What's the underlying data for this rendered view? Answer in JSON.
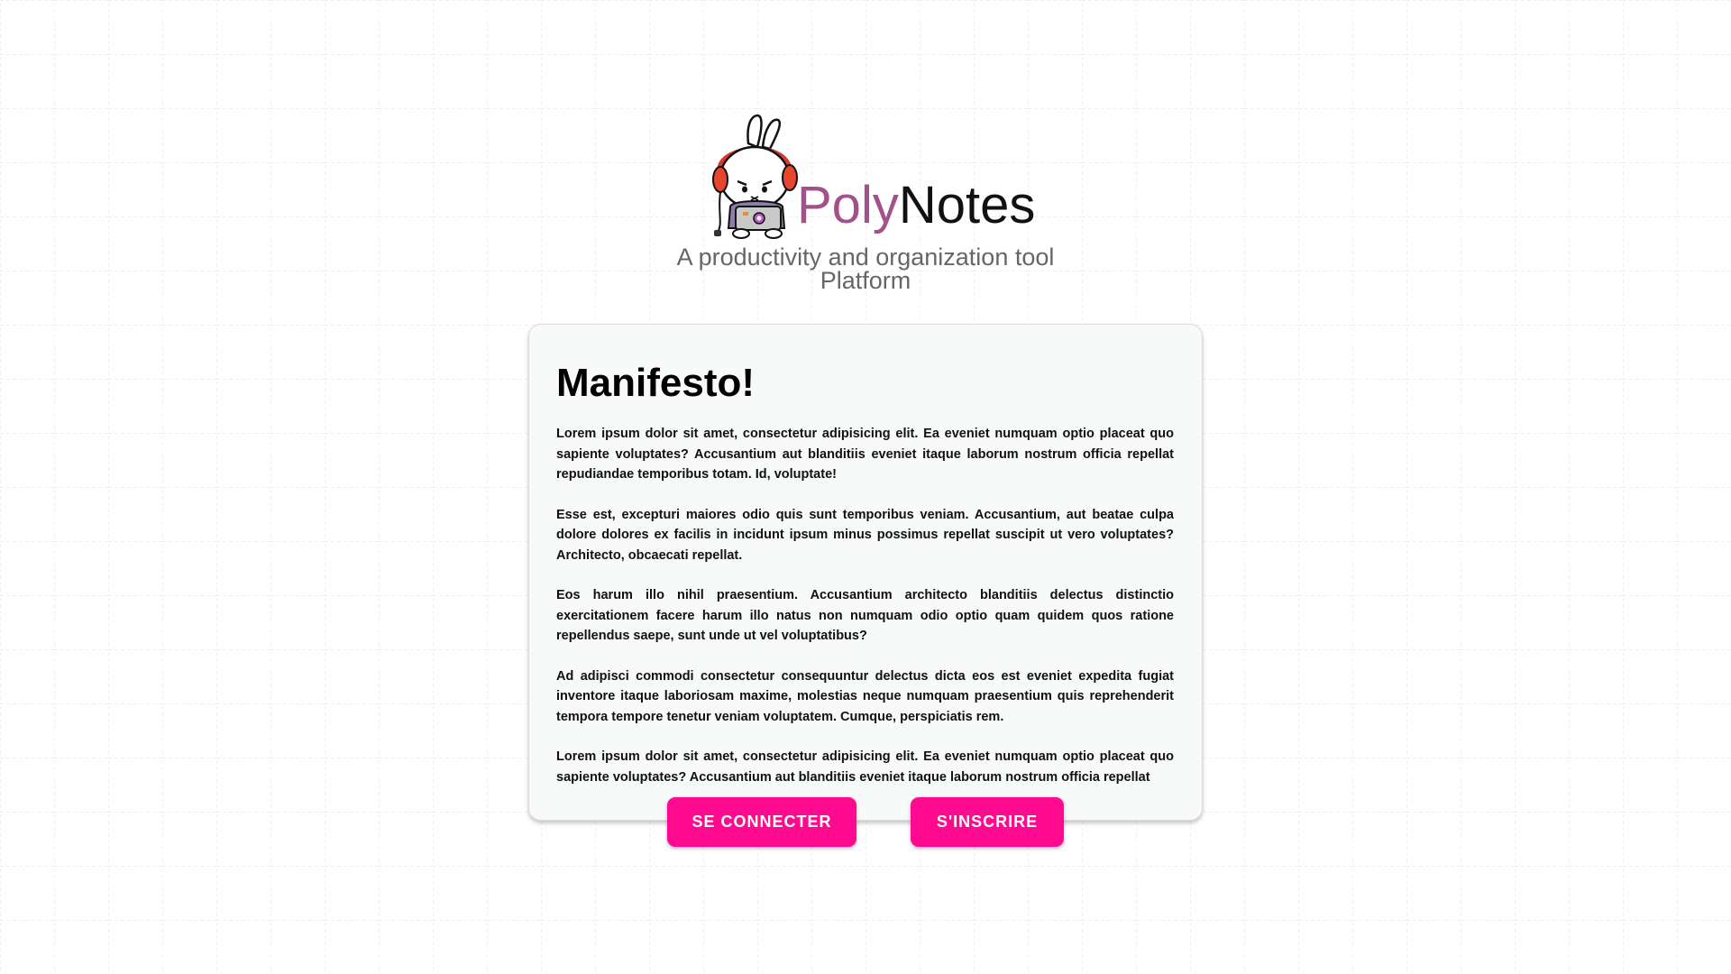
{
  "app": {
    "brand_part1": "Poly",
    "brand_part2": "Notes",
    "tagline": "A productivity and organization tool Platform",
    "mascot_icon": "rabbit-mascot-with-headphones-icon"
  },
  "colors": {
    "background": "#ffffff",
    "grid_line": "#e2e2e2",
    "brand_accent": "#a4508b",
    "button": "#ff0a8f",
    "button_text": "#ffffff",
    "card_background": "#f8f9f9"
  },
  "manifesto": {
    "title": "Manifesto!",
    "paragraphs": [
      "Lorem ipsum dolor sit amet, consectetur adipisicing elit. Ea eveniet numquam optio placeat quo sapiente voluptates? Accusantium aut blanditiis eveniet itaque laborum nostrum officia repellat repudiandae temporibus totam. Id, voluptate!",
      "Esse est, excepturi maiores odio quis sunt temporibus veniam. Accusantium, aut beatae culpa dolore dolores ex facilis in incidunt ipsum minus possimus repellat suscipit ut vero voluptates? Architecto, obcaecati repellat.",
      "Eos harum illo nihil praesentium. Accusantium architecto blanditiis delectus distinctio exercitationem facere harum illo natus non numquam odio optio quam quidem quos ratione repellendus saepe, sunt unde ut vel voluptatibus?",
      "Ad adipisci commodi consectetur consequuntur delectus dicta eos est eveniet expedita fugiat inventore itaque laboriosam maxime, molestias neque numquam praesentium quis reprehenderit tempora tempore tenetur veniam voluptatem. Cumque, perspiciatis rem.",
      "Lorem ipsum dolor sit amet, consectetur adipisicing elit. Ea eveniet numquam optio placeat quo sapiente voluptates? Accusantium aut blanditiis eveniet itaque laborum nostrum officia repellat"
    ]
  },
  "actions": {
    "login_label": "SE CONNECTER",
    "signup_label": "S'INSCRIRE"
  }
}
